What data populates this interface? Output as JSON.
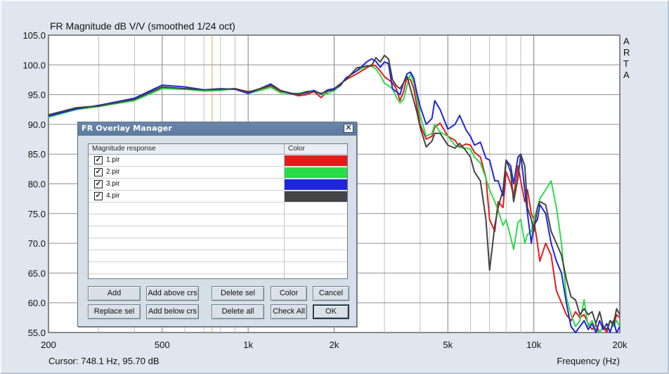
{
  "chart_data": {
    "type": "line",
    "title": "FR Magnitude dB V/V (smoothed 1/24 oct)",
    "xlabel": "Frequency (Hz)",
    "ylabel": "",
    "x_scale": "log",
    "xlim": [
      200,
      20000
    ],
    "ylim": [
      55,
      105
    ],
    "grid": true,
    "y_ticks": [
      "105.0",
      "100.0",
      "95.0",
      "90.0",
      "85.0",
      "80.0",
      "75.0",
      "70.0",
      "65.0",
      "60.0",
      "55.0"
    ],
    "x_ticks": [
      {
        "value": 200,
        "label": "200"
      },
      {
        "value": 500,
        "label": "500"
      },
      {
        "value": 1000,
        "label": "1k"
      },
      {
        "value": 2000,
        "label": "2k"
      },
      {
        "value": 5000,
        "label": "5k"
      },
      {
        "value": 10000,
        "label": "10k"
      },
      {
        "value": 20000,
        "label": "20k"
      }
    ],
    "side_label": [
      "A",
      "R",
      "T",
      "A"
    ],
    "cursor_freq": 748.1,
    "cursor_text": "Cursor: 748.1 Hz, 95.70 dB",
    "background": "#ffffff",
    "grid_color": "#bfbfbf",
    "cursor_color": "#d7b04a",
    "series": [
      {
        "name": "1.pir",
        "color": "#e41b1b",
        "x": [
          200,
          250,
          300,
          400,
          500,
          600,
          700,
          800,
          900,
          1000,
          1100,
          1200,
          1300,
          1400,
          1500,
          1600,
          1700,
          1800,
          1900,
          2000,
          2100,
          2200,
          2400,
          2600,
          2700,
          2800,
          2900,
          3000,
          3100,
          3200,
          3300,
          3400,
          3500,
          3600,
          3700,
          3800,
          3900,
          4000,
          4200,
          4400,
          4500,
          4700,
          5000,
          5300,
          5500,
          5800,
          6000,
          6200,
          6500,
          6800,
          7000,
          7300,
          7500,
          7800,
          8000,
          8300,
          8500,
          8800,
          9000,
          9300,
          9500,
          9800,
          10000,
          10300,
          10500,
          11000,
          11500,
          12000,
          12500,
          13000,
          13500,
          14000,
          14500,
          15000,
          15500,
          16000,
          16500,
          17000,
          17500,
          18000,
          18500,
          19000,
          19500,
          20000
        ],
        "y": [
          91.5,
          92.5,
          93,
          94.2,
          96.2,
          96,
          95.7,
          95.8,
          96,
          95.5,
          95.8,
          96.5,
          95.5,
          95.2,
          94.8,
          95,
          95.5,
          94.5,
          95.6,
          96,
          96.8,
          97.5,
          98.5,
          99.5,
          100,
          99.8,
          99,
          98,
          97.5,
          97,
          96,
          94,
          95.5,
          98,
          97.5,
          96,
          93,
          90,
          87.5,
          88,
          89.5,
          90.2,
          88,
          87.3,
          86.2,
          86.7,
          86.5,
          85.3,
          84.5,
          81,
          74,
          72,
          77,
          76,
          82,
          80,
          78,
          83,
          80.5,
          77,
          79,
          75,
          74,
          70,
          67,
          70,
          68,
          62,
          60,
          58,
          57,
          58.5,
          57.5,
          58,
          56.5,
          55.5,
          56.3,
          55,
          56,
          55,
          57,
          56,
          58,
          57.5
        ]
      },
      {
        "name": "2.pir",
        "color": "#2bdc4a",
        "x": [
          200,
          250,
          300,
          400,
          500,
          600,
          700,
          800,
          900,
          1000,
          1100,
          1200,
          1300,
          1400,
          1500,
          1600,
          1700,
          1800,
          1900,
          2000,
          2100,
          2200,
          2400,
          2600,
          2700,
          2800,
          2900,
          3000,
          3100,
          3200,
          3300,
          3400,
          3500,
          3600,
          3700,
          3800,
          3900,
          4000,
          4200,
          4400,
          4500,
          4700,
          5000,
          5300,
          5500,
          5800,
          6000,
          6200,
          6500,
          6800,
          7000,
          7300,
          7500,
          7800,
          8000,
          8300,
          8500,
          8800,
          9000,
          9300,
          9500,
          9800,
          10000,
          10300,
          10500,
          11000,
          11500,
          12000,
          12500,
          13000,
          13500,
          14000,
          14500,
          15000,
          15500,
          16000,
          16500,
          17000,
          17500,
          18000,
          18500,
          19000,
          19500,
          20000
        ],
        "y": [
          91.2,
          92.5,
          93,
          94,
          96,
          95.9,
          95.6,
          95.7,
          96,
          95.2,
          95.7,
          96.2,
          95.3,
          95.2,
          95.2,
          95.5,
          95.7,
          95,
          95.2,
          95.7,
          96.5,
          97.8,
          99,
          99.8,
          99.8,
          99.3,
          98.3,
          96.9,
          96.5,
          96,
          94.6,
          93.6,
          94.2,
          96.5,
          98.5,
          97,
          94.5,
          91.5,
          88,
          88.5,
          90,
          88.7,
          88,
          86.5,
          86.1,
          86,
          85.8,
          84.5,
          83.5,
          80.9,
          79,
          77,
          75.5,
          73,
          74,
          71,
          69,
          73.5,
          74,
          70,
          71.5,
          72,
          74,
          76,
          77.5,
          79,
          80.5,
          76,
          70,
          61,
          58,
          56,
          57,
          60.5,
          56,
          57,
          55.5,
          55,
          56,
          55.5,
          57,
          56,
          57,
          56
        ]
      },
      {
        "name": "3.pir",
        "color": "#1e25dc",
        "x": [
          200,
          250,
          300,
          400,
          500,
          600,
          700,
          800,
          900,
          1000,
          1100,
          1200,
          1300,
          1400,
          1500,
          1600,
          1700,
          1800,
          1900,
          2000,
          2100,
          2200,
          2400,
          2600,
          2700,
          2800,
          2900,
          3000,
          3100,
          3200,
          3300,
          3400,
          3500,
          3600,
          3700,
          3800,
          3900,
          4000,
          4200,
          4400,
          4500,
          4700,
          5000,
          5300,
          5500,
          5800,
          6000,
          6200,
          6500,
          6800,
          7000,
          7300,
          7500,
          7800,
          8000,
          8300,
          8500,
          8800,
          9000,
          9300,
          9500,
          9800,
          10000,
          10300,
          10500,
          11000,
          11500,
          12000,
          12500,
          13000,
          13500,
          14000,
          14500,
          15000,
          15500,
          16000,
          16500,
          17000,
          17500,
          18000,
          18500,
          19000,
          19500,
          20000
        ],
        "y": [
          91.4,
          92.6,
          93.2,
          94.4,
          96.6,
          96.3,
          95.8,
          96,
          95.9,
          95.2,
          96,
          96.8,
          95.7,
          95.2,
          95.1,
          95.3,
          95.7,
          95.1,
          95.8,
          96,
          96.5,
          97.8,
          99,
          100.5,
          101,
          100.6,
          99.6,
          100.5,
          100.2,
          96,
          95.5,
          95,
          97,
          98.5,
          98.8,
          97.8,
          95.2,
          93,
          90,
          91,
          94,
          92.5,
          89.2,
          90,
          91.5,
          89,
          88,
          86.5,
          87,
          84.3,
          84,
          80.5,
          80.5,
          78,
          84,
          83,
          80,
          84.5,
          85,
          79,
          75,
          70,
          73,
          74,
          76.5,
          75,
          70,
          67,
          65,
          60,
          56,
          55,
          56,
          57,
          55.5,
          56.5,
          55,
          57,
          55.5,
          56.5,
          55,
          57,
          55,
          56
        ]
      },
      {
        "name": "4.pir",
        "color": "#444444",
        "x": [
          200,
          250,
          300,
          400,
          500,
          600,
          700,
          800,
          900,
          1000,
          1100,
          1200,
          1300,
          1400,
          1500,
          1600,
          1700,
          1800,
          1900,
          2000,
          2100,
          2200,
          2400,
          2600,
          2700,
          2800,
          2900,
          3000,
          3100,
          3200,
          3300,
          3400,
          3500,
          3600,
          3700,
          3800,
          3900,
          4000,
          4200,
          4400,
          4500,
          4700,
          5000,
          5300,
          5500,
          5800,
          6000,
          6200,
          6500,
          6800,
          7000,
          7300,
          7500,
          7800,
          8000,
          8300,
          8500,
          8800,
          9000,
          9300,
          9500,
          9800,
          10000,
          10300,
          10500,
          11000,
          11500,
          12000,
          12500,
          13000,
          13500,
          14000,
          14500,
          15000,
          15500,
          16000,
          16500,
          17000,
          17500,
          18000,
          18500,
          19000,
          19500,
          20000
        ],
        "y": [
          91.6,
          92.8,
          93.1,
          94.2,
          96.3,
          96,
          95.8,
          95.9,
          96,
          95.4,
          96,
          96.6,
          95.7,
          95.3,
          95,
          95.5,
          95.5,
          95.2,
          95.6,
          95.8,
          96.8,
          97.5,
          99.5,
          99.8,
          99.8,
          101.2,
          100.5,
          101.6,
          101,
          97.5,
          96.5,
          96,
          97,
          98,
          96,
          94,
          92,
          89.5,
          86.2,
          87.2,
          88.5,
          88.5,
          86.5,
          86,
          86.8,
          85.5,
          84.5,
          82,
          80.5,
          74,
          65.5,
          73,
          76,
          79,
          84,
          82,
          77,
          81,
          85,
          83,
          76,
          74,
          72,
          76,
          77,
          76.5,
          72,
          70,
          68,
          64,
          61,
          60.5,
          58,
          59,
          58,
          58.5,
          56.5,
          58.5,
          56,
          55.5,
          57,
          56.5,
          59,
          58
        ]
      }
    ]
  },
  "dialog": {
    "title": "FR Overlay Manager",
    "close_label": "✕",
    "columns": {
      "magnitude": "Magnitude response",
      "color": "Color"
    },
    "items": [
      {
        "name": "1.pir",
        "checked": true,
        "color": "#e41b1b"
      },
      {
        "name": "2.pir",
        "checked": true,
        "color": "#2bdc4a"
      },
      {
        "name": "3.pir",
        "checked": true,
        "color": "#1e25dc"
      },
      {
        "name": "4.pir",
        "checked": true,
        "color": "#444444"
      }
    ],
    "check_mark": "✓",
    "buttons": {
      "add": "Add",
      "add_above": "Add above crs",
      "delete_sel": "Delete sel",
      "color": "Color",
      "cancel": "Cancel",
      "replace_sel": "Replace sel",
      "add_below": "Add below crs",
      "delete_all": "Delete all",
      "check_all": "Check All",
      "ok": "OK"
    }
  }
}
